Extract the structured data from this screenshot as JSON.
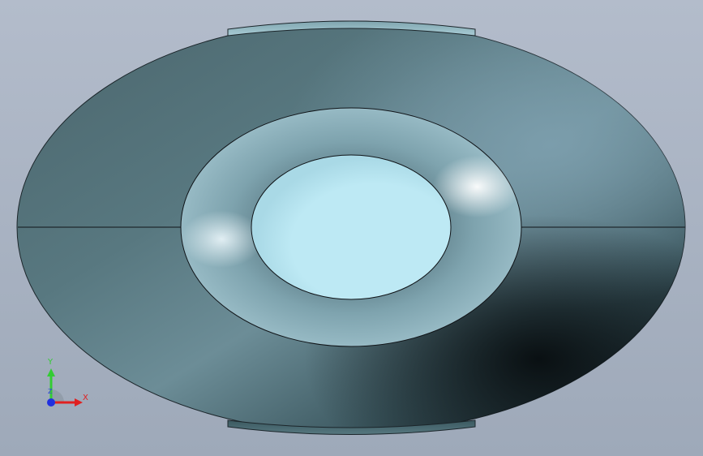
{
  "viewport": {
    "background_top": "#b3bccb",
    "background_bottom": "#9ea9b9"
  },
  "model": {
    "body_color": "#5f7d84",
    "body_shadow_color": "#0f1b20",
    "inner_ring_color": "#9fc2cc",
    "hole_color": "#bde9f4",
    "edge_color": "#101418"
  },
  "triad": {
    "x_label": "X",
    "y_label": "Y",
    "z_label": "Z",
    "x_color": "#e02020",
    "y_color": "#33cc33",
    "z_color": "#2030e0"
  }
}
